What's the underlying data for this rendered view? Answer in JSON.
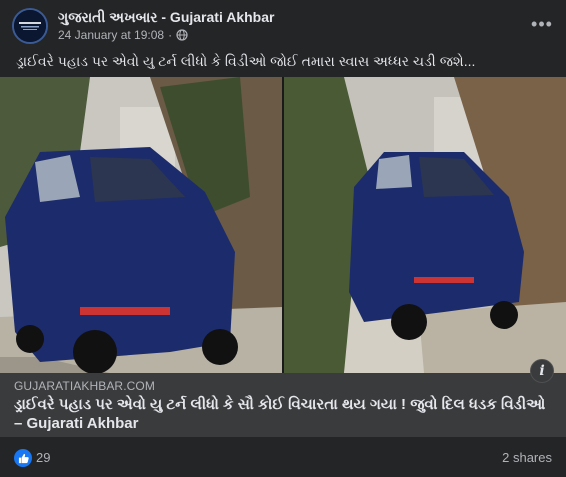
{
  "header": {
    "page_name": "ગુજરાતી અખબાર - Gujarati Akhbar",
    "timestamp": "24 January at 19:08",
    "separator": "·",
    "more_icon": "ellipsis-icon",
    "privacy_icon": "globe-icon"
  },
  "post": {
    "text": "ડ્રાઈવરે પહાડ પર એવો યુ ટર્ન લીધો કે વિડીઓ જોઈ તમારા સ્વાસ અધ્ધર ચડી જશે..."
  },
  "link_preview": {
    "domain": "GUJARATIAKHBAR.COM",
    "title": "ડ્રાઈવરે પહાડ પર એવો યુ ટર્ન લીધો કે સૌ કોઈ વિચારતા થય ગયા ! જુવો દિલ ધડક વિડીઓ – Gujarati Akhbar",
    "info_icon": "info-icon"
  },
  "footer": {
    "reaction_icon": "like-icon",
    "reaction_count": "29",
    "shares": "2 shares"
  },
  "colors": {
    "background": "#242526",
    "link_background": "#3a3b3c",
    "like_blue": "#1877f2",
    "secondary_text": "#b0b3b8",
    "primary_text": "#e4e6eb"
  }
}
